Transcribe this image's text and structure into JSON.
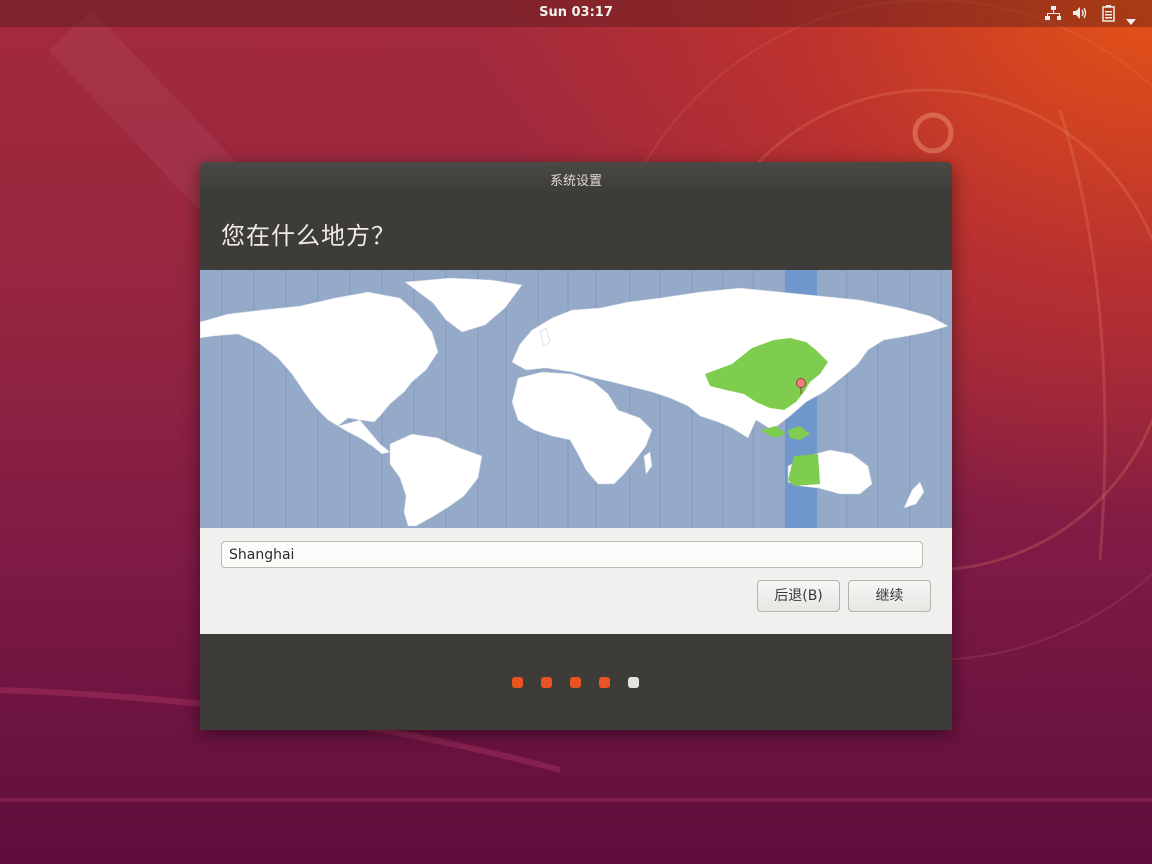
{
  "top_bar": {
    "clock": "Sun 03:17",
    "tray_icons": [
      "network-icon",
      "volume-icon",
      "battery-icon",
      "menu-caret-icon"
    ]
  },
  "window": {
    "title": "系统设置",
    "heading": "您在什么地方？",
    "location": {
      "value": "Shanghai",
      "placeholder": ""
    },
    "buttons": {
      "back": "后退(B)",
      "continue": "继续"
    },
    "progress": {
      "total_steps": 5,
      "current_step": 5,
      "completed_color": "#e95420",
      "current_color": "#e5e3df"
    }
  },
  "colors": {
    "map_water": "#94aac8",
    "map_land": "#ffffff",
    "selected_zone_land": "#7fcd4f",
    "selected_zone_band": "#6f97cb"
  }
}
